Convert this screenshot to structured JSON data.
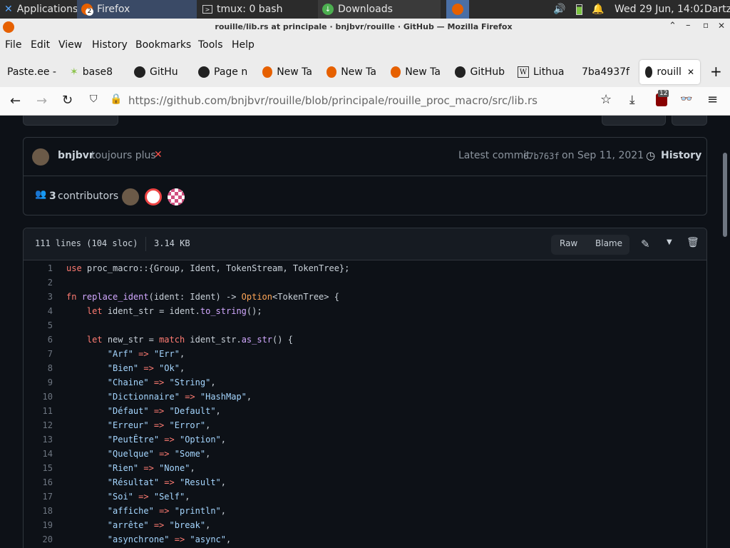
{
  "taskbar": {
    "applications": "Applications",
    "firefox_task": "Firefox",
    "firefox_badge": "2",
    "tmux_task": "tmux: 0 bash",
    "downloads_task": "Downloads",
    "datetime": "Wed 29 Jun, 14:02",
    "user": "Dartz"
  },
  "window": {
    "title": "rouille/lib.rs at principale · bnjbvr/rouille · GitHub — Mozilla Firefox"
  },
  "menu": [
    "File",
    "Edit",
    "View",
    "History",
    "Bookmarks",
    "Tools",
    "Help"
  ],
  "tabs": [
    {
      "label": "Paste.ee -"
    },
    {
      "label": "base8"
    },
    {
      "label": "GitHu"
    },
    {
      "label": "Page n"
    },
    {
      "label": "New Ta"
    },
    {
      "label": "New Ta"
    },
    {
      "label": "New Ta"
    },
    {
      "label": "GitHub"
    },
    {
      "label": "Lithua"
    },
    {
      "label": "7ba4937f"
    },
    {
      "label": "rouill"
    }
  ],
  "nav": {
    "url_prefix": "https://github.com",
    "url_path": "/bnjbvr/rouille/blob/principale/rouille_proc_macro/src/lib.rs",
    "badge": "12"
  },
  "commit": {
    "author": "bnjbvr",
    "message": "toujours plus",
    "prefix": "Latest commit",
    "hash": "67b763f",
    "date": "on Sep 11, 2021",
    "history": "History"
  },
  "contributors": {
    "count": "3",
    "label": "contributors"
  },
  "file": {
    "lines": "111 lines (104 sloc)",
    "size": "3.14 KB",
    "raw": "Raw",
    "blame": "Blame"
  },
  "code": [
    {
      "n": "1",
      "html": "<span class='kw'>use</span> proc_macro::{Group, Ident, TokenStream, TokenTree};"
    },
    {
      "n": "2",
      "html": ""
    },
    {
      "n": "3",
      "html": "<span class='kw'>fn</span> <span class='fn'>replace_ident</span>(ident: Ident) -&gt; <span class='typ'>Option</span>&lt;TokenTree&gt; {"
    },
    {
      "n": "4",
      "html": "    <span class='kw'>let</span> ident_str = ident.<span class='fn'>to_string</span>();"
    },
    {
      "n": "5",
      "html": ""
    },
    {
      "n": "6",
      "html": "    <span class='kw'>let</span> new_str = <span class='kw'>match</span> ident_str.<span class='fn'>as_str</span>() {"
    },
    {
      "n": "7",
      "html": "        <span class='str'>\"Arf\"</span> <span class='kw'>=&gt;</span> <span class='str'>\"Err\"</span>,"
    },
    {
      "n": "8",
      "html": "        <span class='str'>\"Bien\"</span> <span class='kw'>=&gt;</span> <span class='str'>\"Ok\"</span>,"
    },
    {
      "n": "9",
      "html": "        <span class='str'>\"Chaine\"</span> <span class='kw'>=&gt;</span> <span class='str'>\"String\"</span>,"
    },
    {
      "n": "10",
      "html": "        <span class='str'>\"Dictionnaire\"</span> <span class='kw'>=&gt;</span> <span class='str'>\"HashMap\"</span>,"
    },
    {
      "n": "11",
      "html": "        <span class='str'>\"Défaut\"</span> <span class='kw'>=&gt;</span> <span class='str'>\"Default\"</span>,"
    },
    {
      "n": "12",
      "html": "        <span class='str'>\"Erreur\"</span> <span class='kw'>=&gt;</span> <span class='str'>\"Error\"</span>,"
    },
    {
      "n": "13",
      "html": "        <span class='str'>\"PeutÊtre\"</span> <span class='kw'>=&gt;</span> <span class='str'>\"Option\"</span>,"
    },
    {
      "n": "14",
      "html": "        <span class='str'>\"Quelque\"</span> <span class='kw'>=&gt;</span> <span class='str'>\"Some\"</span>,"
    },
    {
      "n": "15",
      "html": "        <span class='str'>\"Rien\"</span> <span class='kw'>=&gt;</span> <span class='str'>\"None\"</span>,"
    },
    {
      "n": "16",
      "html": "        <span class='str'>\"Résultat\"</span> <span class='kw'>=&gt;</span> <span class='str'>\"Result\"</span>,"
    },
    {
      "n": "17",
      "html": "        <span class='str'>\"Soi\"</span> <span class='kw'>=&gt;</span> <span class='str'>\"Self\"</span>,"
    },
    {
      "n": "18",
      "html": "        <span class='str'>\"affiche\"</span> <span class='kw'>=&gt;</span> <span class='str'>\"println\"</span>,"
    },
    {
      "n": "19",
      "html": "        <span class='str'>\"arrête\"</span> <span class='kw'>=&gt;</span> <span class='str'>\"break\"</span>,"
    },
    {
      "n": "20",
      "html": "        <span class='str'>\"asynchrone\"</span> <span class='kw'>=&gt;</span> <span class='str'>\"async\"</span>,"
    }
  ]
}
